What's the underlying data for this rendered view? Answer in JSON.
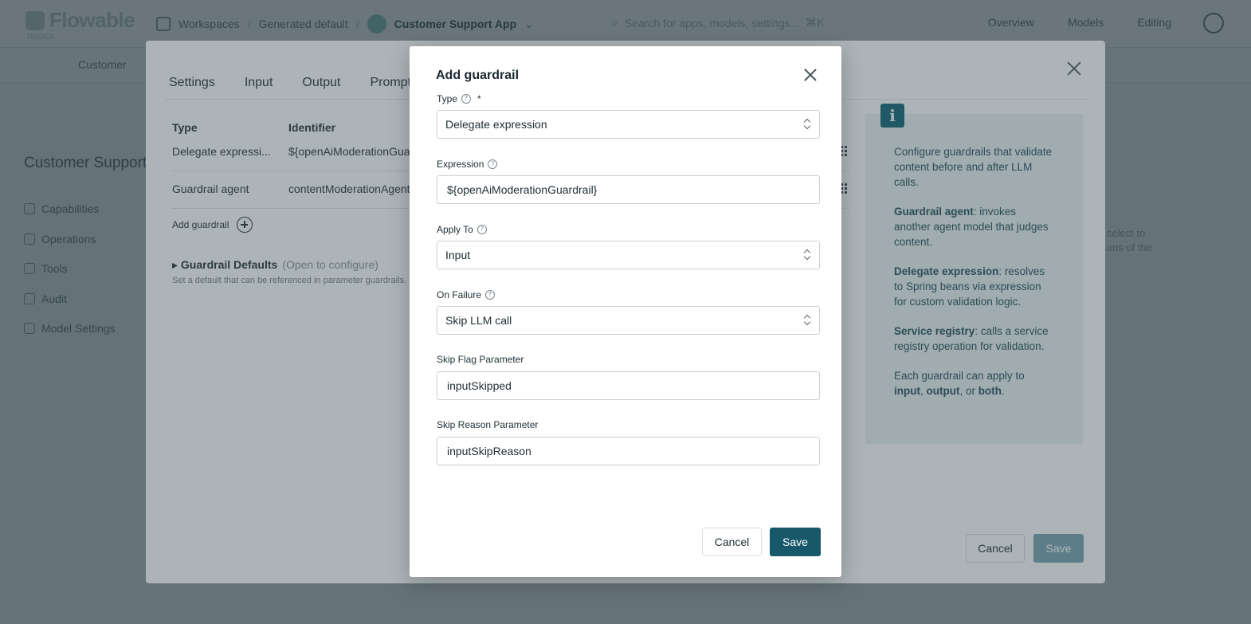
{
  "topbar": {
    "logo_text": "Flowable",
    "logo_sub": "DESIGN",
    "breadcrumbs": [
      "Workspaces",
      "Generated default"
    ],
    "app_name": "Customer Support App",
    "search_placeholder": "Search for apps, models, settings...",
    "search_shortcut": "⌘K",
    "nav": [
      "Overview",
      "Models",
      "Editing"
    ]
  },
  "subbar": {
    "customer_label": "Customer"
  },
  "sidebar": {
    "title": "Customer Support",
    "items": [
      "Capabilities",
      "Operations",
      "Tools",
      "Audit",
      "Model Settings"
    ]
  },
  "background_right_text": [
    "...select to",
    "...ons of the"
  ],
  "agent_modal": {
    "tabs": [
      "Settings",
      "Input",
      "Output",
      "Prompt"
    ],
    "table": {
      "headers": [
        "Type",
        "Identifier"
      ],
      "rows": [
        {
          "type": "Delegate expressi...",
          "identifier": "${openAiModerationGuardrail}"
        },
        {
          "type": "Guardrail agent",
          "identifier": "contentModerationAgent"
        }
      ]
    },
    "add_guardrail_label": "Add guardrail",
    "defaults_title": "▸ Guardrail Defaults",
    "defaults_hint": "(Open to configure)",
    "defaults_sub": "Set a default that can be referenced in parameter guardrails.",
    "info": {
      "p1": "Configure guardrails that validate content before and after LLM calls.",
      "p2_strong": "Guardrail agent",
      "p2_rest": ": invokes another agent model that judges content.",
      "p3_strong": "Delegate expression",
      "p3_rest": ": resolves to Spring beans via expression for custom validation logic.",
      "p4_strong": "Service registry",
      "p4_rest": ": calls a service registry operation for validation.",
      "p5_a": "Each guardrail can apply to ",
      "p5_input": "input",
      "p5_comma": ", ",
      "p5_output": "output",
      "p5_or": ", or ",
      "p5_both": "both",
      "p5_end": "."
    },
    "cancel_label": "Cancel",
    "save_label": "Save"
  },
  "dialog": {
    "title": "Add guardrail",
    "type": {
      "label": "Type",
      "required_mark": "*",
      "value": "Delegate expression",
      "help_glyph": "?"
    },
    "expression": {
      "label": "Expression",
      "value": "${openAiModerationGuardrail}",
      "help_glyph": "?"
    },
    "apply_to": {
      "label": "Apply To",
      "value": "Input",
      "help_glyph": "?"
    },
    "on_failure": {
      "label": "On Failure",
      "value": "Skip LLM call",
      "help_glyph": "?"
    },
    "skip_flag": {
      "label": "Skip Flag Parameter",
      "value": "inputSkipped"
    },
    "skip_reason": {
      "label": "Skip Reason Parameter",
      "value": "inputSkipReason"
    },
    "cancel_label": "Cancel",
    "save_label": "Save"
  },
  "colors": {
    "primary": "#17596a",
    "overlay": "#283a42",
    "info_bg": "#eaf3f4"
  }
}
